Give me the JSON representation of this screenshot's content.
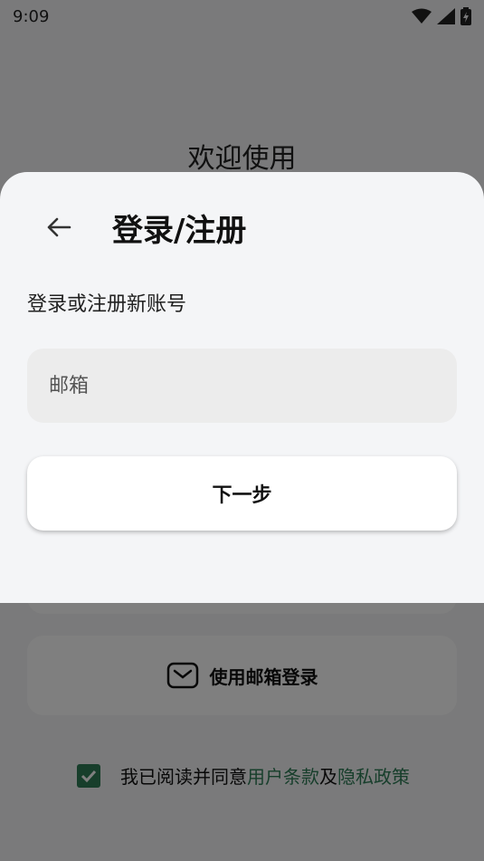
{
  "status_bar": {
    "time": "9:09",
    "icons": [
      "wifi-icon",
      "cell-signal-icon",
      "battery-charging-icon"
    ]
  },
  "background": {
    "welcome_title": "欢迎使用",
    "email_login_label": "使用邮箱登录",
    "agreement": {
      "checked": true,
      "prefix": "我已阅读并同意",
      "terms_link": "用户条款",
      "and": "及",
      "privacy_link": "隐私政策"
    }
  },
  "sheet": {
    "title": "登录/注册",
    "subtitle": "登录或注册新账号",
    "email_placeholder": "邮箱",
    "email_value": "",
    "next_label": "下一步"
  },
  "colors": {
    "accent_green": "#2e7d57",
    "sheet_bg": "#f4f5f7",
    "input_bg": "#ececec"
  }
}
